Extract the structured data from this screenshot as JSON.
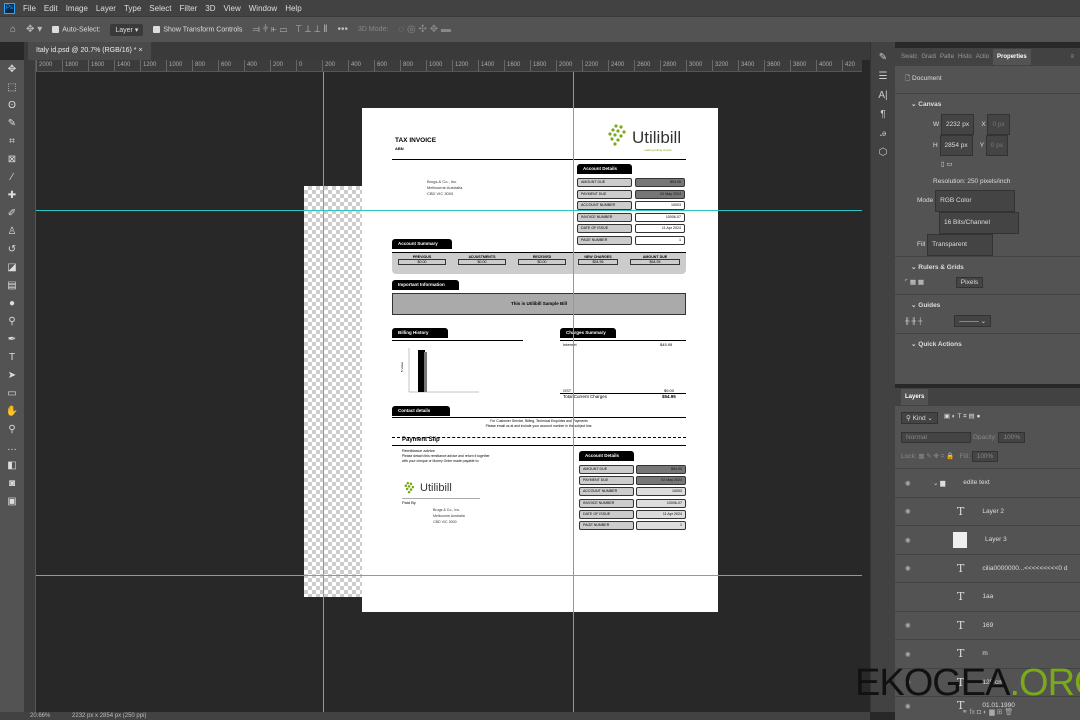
{
  "app": {
    "menu": [
      "File",
      "Edit",
      "Image",
      "Layer",
      "Type",
      "Select",
      "Filter",
      "3D",
      "View",
      "Window",
      "Help"
    ],
    "options": {
      "auto_select": "Auto-Select:",
      "auto_select_target": "Layer",
      "show_transform": "Show Transform Controls",
      "mode3d": "3D Mode:"
    },
    "tab": "Italy id.psd @ 20.7% (RGB/16) *",
    "ruler": [
      "2000",
      "1800",
      "1600",
      "1400",
      "1200",
      "1000",
      "800",
      "600",
      "400",
      "200",
      "0",
      "200",
      "400",
      "600",
      "800",
      "1000",
      "1200",
      "1400",
      "1600",
      "1800",
      "2000",
      "2200",
      "2400",
      "2600",
      "2800",
      "3000",
      "3200",
      "3400",
      "3600",
      "3800",
      "4000",
      "420"
    ],
    "status": {
      "zoom": "20.66%",
      "size": "2232 px x 2854 px (250 ppi)"
    }
  },
  "invoice": {
    "title": "TAX INVOICE",
    "abn": "ABN",
    "brand": "Utilibill",
    "tagline": "making billing simple",
    "address": [
      "Brugs & Co., Inc.",
      "Melbourne Australia",
      "CBD VIC 3000"
    ],
    "details_title": "Account Details",
    "details": [
      {
        "label": "AMOUNT DUE",
        "value": "$54.95"
      },
      {
        "label": "PAYMENT DUE",
        "value": "02 May 2024"
      },
      {
        "label": "ACCOUNT NUMBER",
        "value": "10003"
      },
      {
        "label": "INVOICE NUMBER",
        "value": "10006-07"
      },
      {
        "label": "DATE OF ISSUE",
        "value": "11 Apr 2024"
      },
      {
        "label": "PAGE NUMBER",
        "value": "1"
      }
    ],
    "summary_title": "Account Summary",
    "summary": [
      {
        "label": "PREVIOUS",
        "value": "$0.00"
      },
      {
        "label": "ADJUSTMENTS",
        "value": "$0.00"
      },
      {
        "label": "RECEIVED",
        "value": "$0.00"
      },
      {
        "label": "NEW CHARGES",
        "value": "$54.95"
      },
      {
        "label": "AMOUNT DUE",
        "value": "$54.95"
      }
    ],
    "important_title": "Important Information",
    "important_text": "This is Utilibill Sample Bill",
    "billing_title": "Billing History",
    "billing_ylabel": "$ Value",
    "charges_title": "Charges Summary",
    "charges": [
      {
        "label": "Internet",
        "value": "$45.95"
      }
    ],
    "gst": {
      "label": "GST",
      "value": "$9.00"
    },
    "total": {
      "label": "Total Current Charges",
      "value": "$54.95"
    },
    "contact_title": "Contact details",
    "contact_lines": [
      "For Customer Service, Billing, Technical Enquiries and Payments",
      "Please email us at and include your account number in the subject line."
    ],
    "slip_title": "Payment Slip",
    "remit": "Remittance advice",
    "remit_text": [
      "Please detach this remittance advice and return it together",
      "with your cheque or Money Order made payable to:"
    ],
    "paid_by": "Paid By"
  },
  "properties": {
    "tabs": [
      "Swatc",
      "Gradi",
      "Patte",
      "Histo",
      "Actio",
      "Properties"
    ],
    "doc": "Document",
    "canvas": "Canvas",
    "w": "2232 px",
    "h": "2854 px",
    "x": "0 px",
    "y": "0 px",
    "W": "W",
    "H": "H",
    "X": "X",
    "Y": "Y",
    "resolution": "Resolution: 250 pixels/inch",
    "mode_label": "Mode",
    "mode": "RGB Color",
    "depth": "16 Bits/Channel",
    "fill_label": "Fill",
    "fill": "Transparent",
    "rulers": "Rulers & Grids",
    "units": "Pixels",
    "guides": "Guides",
    "quick": "Quick Actions"
  },
  "layers": {
    "title": "Layers",
    "kind": "Kind",
    "blend": "Normal",
    "opacity_label": "Opacity:",
    "opacity": "100%",
    "lock": "Lock:",
    "fill_label": "Fill:",
    "fill": "100%",
    "items": [
      {
        "name": "edite text",
        "type": "group"
      },
      {
        "name": "Layer 2",
        "type": "text"
      },
      {
        "name": "Layer 3",
        "type": "image"
      },
      {
        "name": "cilia0000000...<<<<<<<<<0 d",
        "type": "text"
      },
      {
        "name": "1aa",
        "type": "text"
      },
      {
        "name": "169",
        "type": "text"
      },
      {
        "name": "m",
        "type": "text"
      },
      {
        "name": "125 cm",
        "type": "text"
      },
      {
        "name": "01.01.1990",
        "type": "text"
      }
    ]
  },
  "watermark": "EKOGEA.ORG",
  "colors": {
    "guide": "#2ec4c4",
    "brand_green": "#7aaa1a"
  }
}
